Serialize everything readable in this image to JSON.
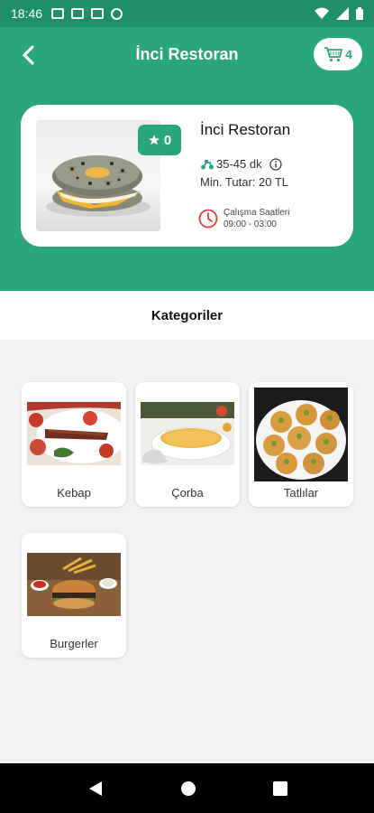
{
  "status_bar": {
    "time": "18:46"
  },
  "header": {
    "title": "İnci Restoran",
    "cart_count": "4"
  },
  "restaurant": {
    "name": "İnci Restoran",
    "rating": "0",
    "delivery_time": "35-45 dk",
    "min_order": "Min. Tutar: 20 TL",
    "hours_label": "Çalışma Saatleri",
    "hours_value": "09:00 - 03:00"
  },
  "categories_title": "Kategoriler",
  "categories": [
    {
      "label": "Kebap"
    },
    {
      "label": "Çorba"
    },
    {
      "label": "Tatlılar"
    },
    {
      "label": "Burgerler"
    }
  ],
  "colors": {
    "primary": "#2aa77a",
    "status_bar": "#1e8f66",
    "hours_icon": "#e03c3c"
  }
}
